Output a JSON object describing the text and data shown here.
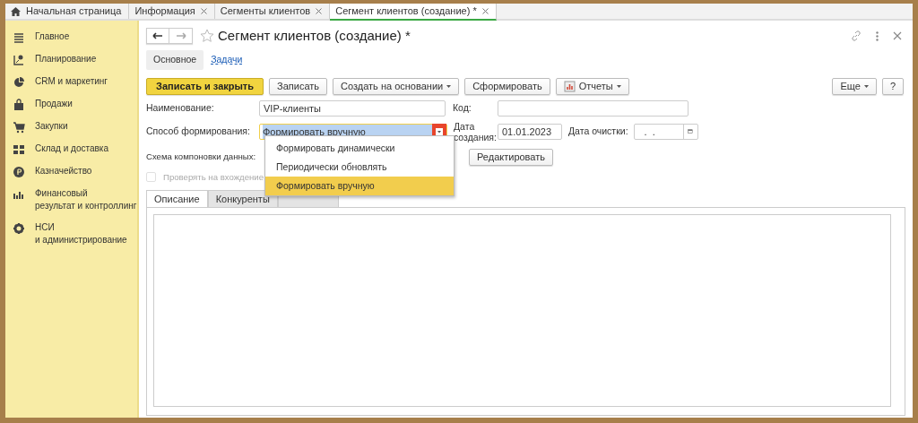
{
  "open_tabs": [
    {
      "label": "Начальная страница",
      "kind": "home",
      "selected": false,
      "closable": false
    },
    {
      "label": "Информация",
      "kind": "page",
      "selected": false,
      "closable": true
    },
    {
      "label": "Сегменты клиентов",
      "kind": "page",
      "selected": false,
      "closable": true
    },
    {
      "label": "Сегмент клиентов (создание) *",
      "kind": "page",
      "selected": true,
      "closable": true
    }
  ],
  "sidebar": {
    "items": [
      {
        "label": "Главное"
      },
      {
        "label": "Планирование"
      },
      {
        "label": "CRM и маркетинг"
      },
      {
        "label": "Продажи"
      },
      {
        "label": "Закупки"
      },
      {
        "label": "Склад и доставка"
      },
      {
        "label": "Казначейство"
      },
      {
        "label": "Финансовый\nрезультат и контроллинг"
      },
      {
        "label": "НСИ\nи администрирование"
      }
    ]
  },
  "form": {
    "title": "Сегмент клиентов (создание) *",
    "sections": [
      {
        "label": "Основное",
        "selected": true
      },
      {
        "label": "Задачи",
        "selected": false
      }
    ],
    "toolbar": [
      {
        "label": "Записать и закрыть",
        "kind": "primary"
      },
      {
        "label": "Записать",
        "kind": "plain"
      },
      {
        "label": "Создать на основании",
        "kind": "menu"
      },
      {
        "label": "Сформировать",
        "kind": "plain"
      },
      {
        "label": "Отчеты",
        "kind": "reports"
      }
    ],
    "toolbar_right": [
      {
        "label": "Еще",
        "kind": "menu"
      },
      {
        "label": "?",
        "kind": "plain"
      }
    ],
    "name_label": "Наименование:",
    "name_value": "VIP-клиенты",
    "code_label": "Код:",
    "method_label": "Способ формирования:",
    "method_value": "Формировать вручную",
    "created_label": "Дата\nсоздания:",
    "created_value": "01.01.2023",
    "clear_label": "Дата очистки:",
    "clear_value": " .  .",
    "schema_label": "Схема компоновки данных:",
    "edit_button": "Редактировать",
    "check": {
      "label": "Проверять на вхождение",
      "checked": false,
      "disabled": true
    },
    "tabs": [
      {
        "label": "Описание",
        "selected": true
      },
      {
        "label": "Конкуренты",
        "selected": false
      },
      {
        "selected": false
      }
    ]
  },
  "dropdown": {
    "options": [
      {
        "label": "Формировать динамически",
        "selected": false
      },
      {
        "label": "Периодически обновлять",
        "selected": false
      },
      {
        "label": "Формировать вручную",
        "selected": true
      }
    ]
  }
}
